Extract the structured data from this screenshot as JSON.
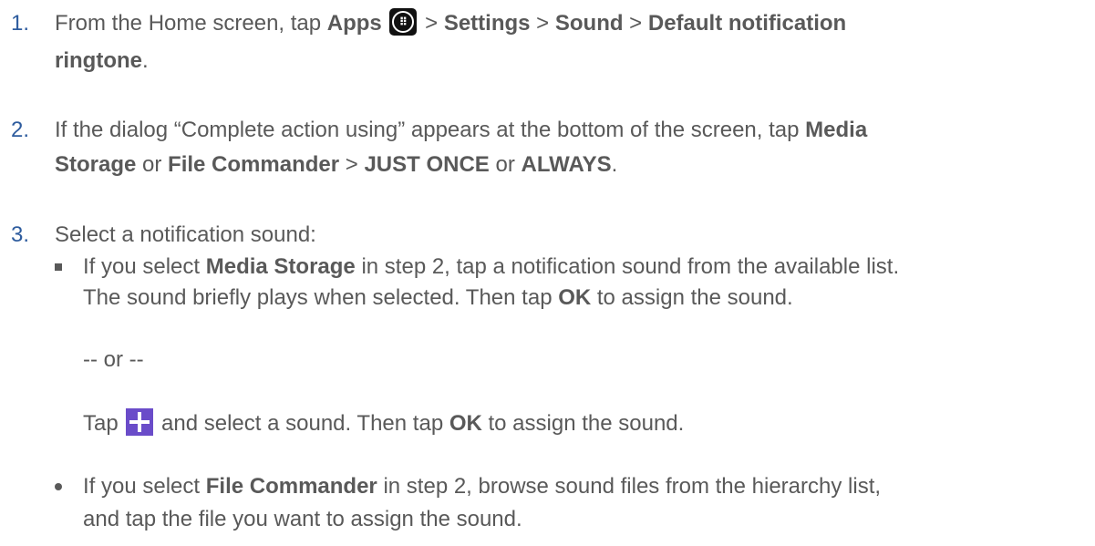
{
  "steps": [
    {
      "number": "1.",
      "line1_a": "From the Home screen, tap ",
      "apps": "Apps",
      "sep1": " > ",
      "settings": "Settings",
      "sep2": " > ",
      "sound": "Sound",
      "sep3": " > ",
      "default_notification": "Default notification",
      "ringtone": "ringtone",
      "end": "."
    },
    {
      "number": "2.",
      "line1_a": "If the dialog “Complete action using” appears at the bottom of the screen, tap ",
      "media": "Media",
      "storage": "Storage",
      "or1": " or ",
      "file_commander": "File Commander",
      "sep": " > ",
      "just_once": "JUST ONCE",
      "or2": " or ",
      "always": "ALWAYS",
      "end": "."
    },
    {
      "number": "3.",
      "text": "Select a notification sound:"
    }
  ],
  "sub_a": {
    "l1_a": "If you select ",
    "l1_b": "Media Storage",
    "l1_c": " in step 2, tap a notification sound from the available list.",
    "l2_a": "The sound briefly plays when selected. Then tap ",
    "l2_b": "OK",
    "l2_c": " to assign the sound.",
    "or_text": "-- or --",
    "l3_a": "Tap ",
    "l3_b": " and select a sound. Then tap ",
    "l3_c": "OK",
    "l3_d": " to assign the sound."
  },
  "sub_b": {
    "l1_a": "If you select ",
    "l1_b": "File Commander",
    "l1_c": " in step 2, browse sound files from the hierarchy list,",
    "l2": "and tap the file you want to assign the sound."
  },
  "icons": {
    "apps_icon": "apps-grid-icon",
    "plus_icon": "plus-icon",
    "plus_color": "#6a4cc9",
    "number_color": "#2e5c9e"
  }
}
